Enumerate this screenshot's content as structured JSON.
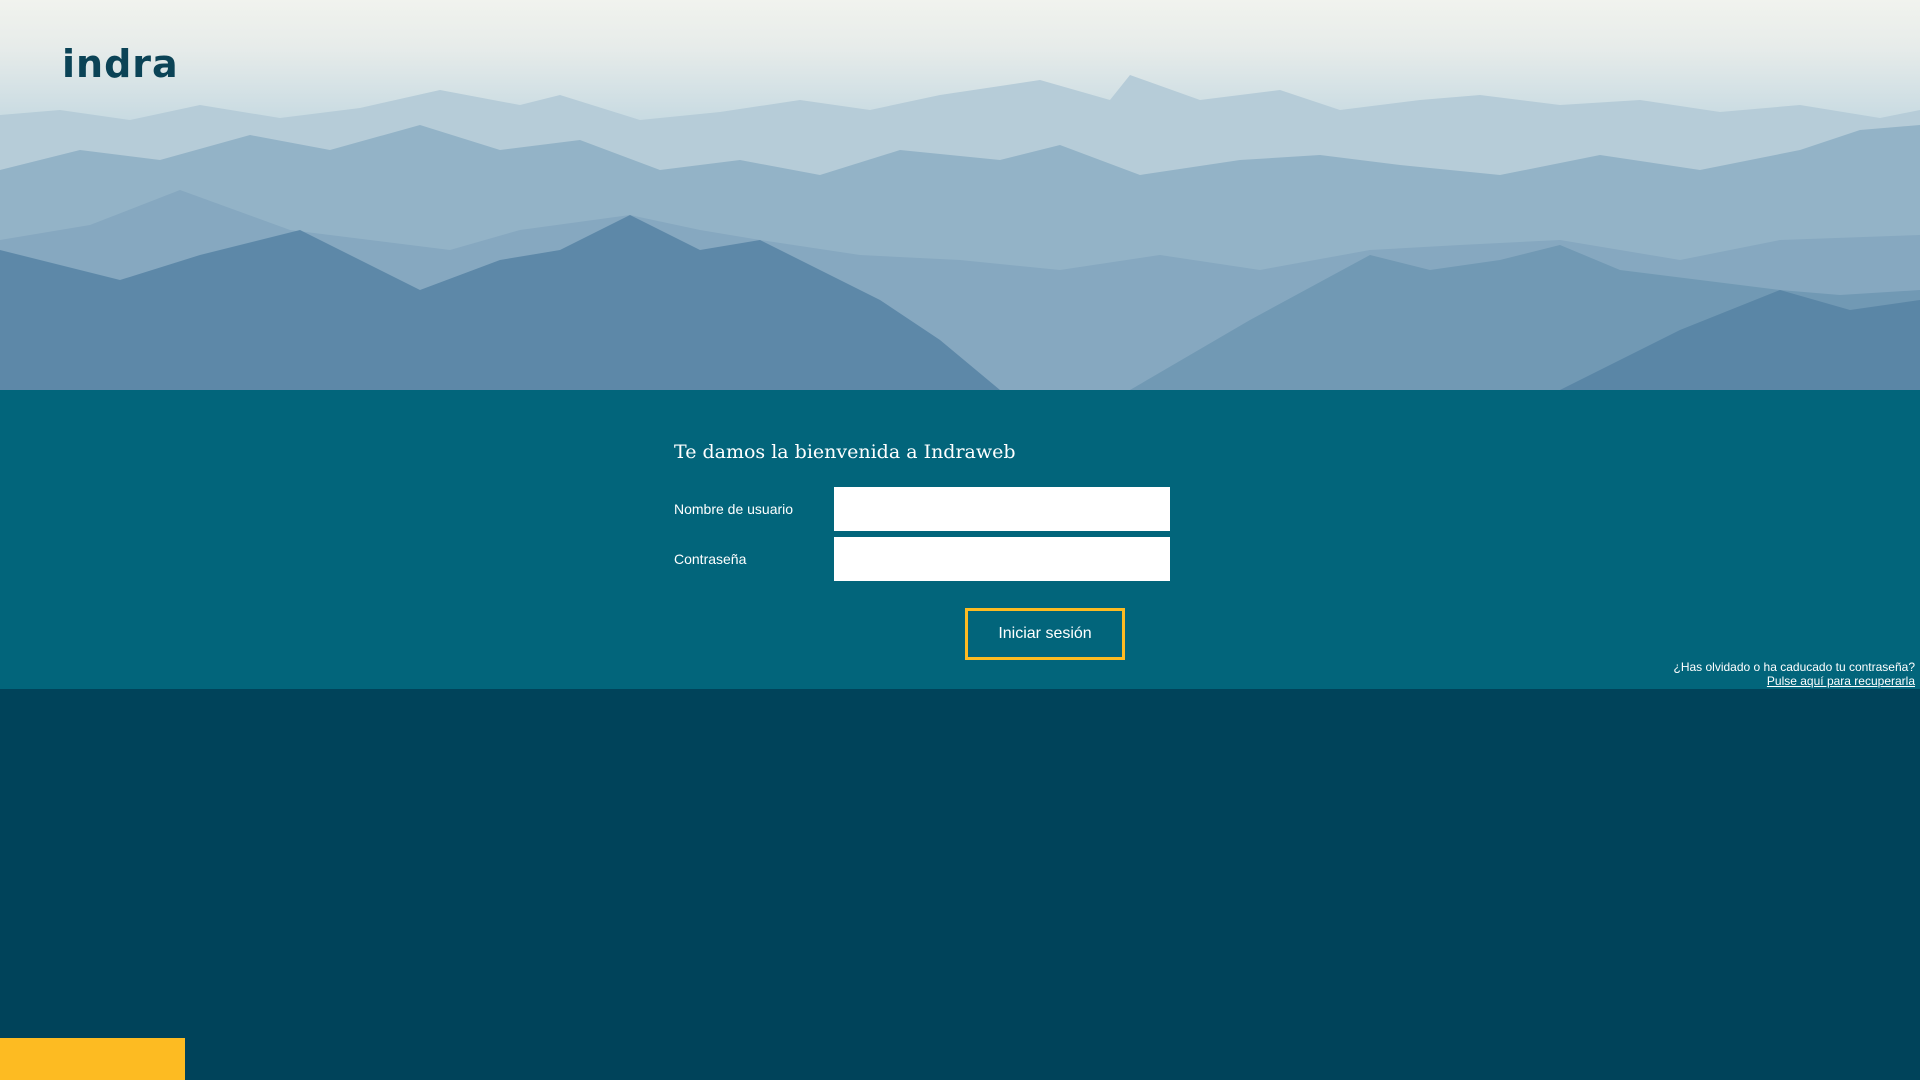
{
  "brand": {
    "logo": "indra"
  },
  "login": {
    "title": "Te damos la bienvenida a Indraweb",
    "username_label": "Nombre de usuario",
    "username_value": "",
    "password_label": "Contraseña",
    "password_value": "",
    "submit_label": "Iniciar sesión"
  },
  "recovery": {
    "question": "¿Has olvidado o ha caducado tu contraseña?",
    "link": "Pulse aquí para recuperarla"
  },
  "colors": {
    "band": "#02657b",
    "footer": "#00435a",
    "accent": "#fdbb22",
    "logo": "#0b4356"
  }
}
